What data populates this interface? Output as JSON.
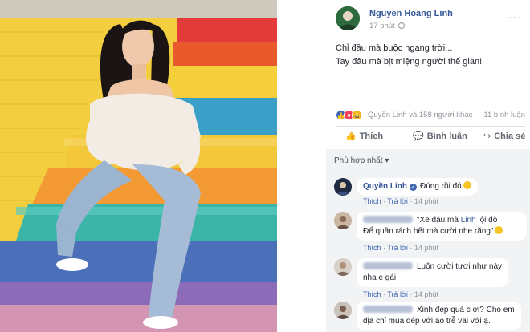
{
  "post": {
    "author": "Nguyen Hoang Linh",
    "timestamp": "17 phút",
    "menu_glyph": "···",
    "status_lines": [
      "Chỉ đâu mà buộc ngang trời...",
      "Tay đâu mà bịt miệng người thế gian!"
    ]
  },
  "reactions": {
    "summary": "Quyền Linh và 158 người khác",
    "comments_count": "11 bình luận",
    "icons": [
      "like-icon",
      "love-icon",
      "haha-icon"
    ]
  },
  "actions": {
    "like": "Thích",
    "comment": "Bình luận",
    "share": "Chia sẻ"
  },
  "comments_section": {
    "sort_label": "Phù hợp nhất ▾",
    "comments": [
      {
        "author": "Quyền Linh",
        "verified": true,
        "text": "Đúng rồi đó",
        "like_label": "Thích",
        "reply_label": "Trả lời",
        "time": "14 phút"
      },
      {
        "author": "",
        "text_before_mention": "\"Xe đâu mà ",
        "mention": "Linh",
        "text_after_mention": " lội dò",
        "text_line2": "Để quần rách hết mà cười nhe răng\"",
        "like_label": "Thích",
        "reply_label": "Trả lời",
        "time": "14 phút"
      },
      {
        "author": "",
        "text_line1": "Luôn cười tươi như này",
        "text_line2": "nha e gái",
        "like_label": "Thích",
        "reply_label": "Trả lời",
        "time": "14 phút"
      },
      {
        "author": "",
        "text_line1": "Xinh đẹp quá c ơi? Cho em",
        "text_line2": "địa chỉ mua dép với áo trễ vai với ạ."
      }
    ]
  },
  "colors": {
    "link_blue": "#365899",
    "facebook_blue": "#4267b2",
    "muted_gray": "#90949c",
    "comment_bg": "#f2f3f5"
  }
}
